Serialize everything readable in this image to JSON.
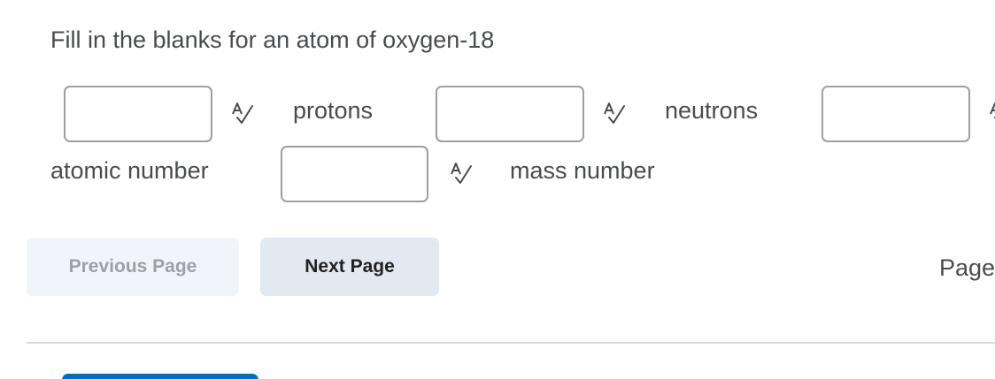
{
  "question": {
    "text": "Fill in the blanks for an atom of oxygen-18"
  },
  "blanks": [
    {
      "value": "",
      "after_label": "protons"
    },
    {
      "value": "",
      "after_label": "neutrons"
    },
    {
      "value": "",
      "after_label": ""
    },
    {
      "value": "",
      "after_label": "mass number"
    }
  ],
  "labels": {
    "protons": "protons",
    "neutrons": "neutrons",
    "atomic_number": "atomic number",
    "mass_number": "mass number"
  },
  "navigation": {
    "previous_label": "Previous Page",
    "next_label": "Next Page",
    "page_label": "Page"
  },
  "icons": {
    "spell_check": "spell-check-icon"
  },
  "colors": {
    "text": "#494c4e",
    "input_border": "#9ca0a5",
    "primary": "#006fbf",
    "prev_bg": "#f1f5fb",
    "next_bg": "#e3e9f1"
  }
}
